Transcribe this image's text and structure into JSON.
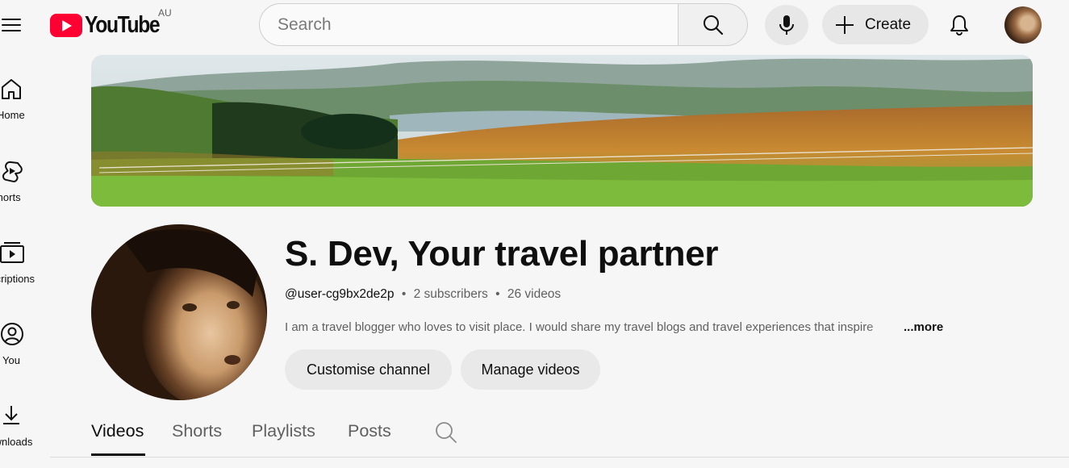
{
  "header": {
    "logo_text": "YouTube",
    "country_code": "AU",
    "search_placeholder": "Search",
    "create_label": "Create"
  },
  "sidebar": {
    "items": [
      {
        "label": "Home",
        "icon": "home-icon"
      },
      {
        "label": "Shorts",
        "icon": "shorts-icon"
      },
      {
        "label": "Subscriptions",
        "icon": "subscriptions-icon"
      },
      {
        "label": "You",
        "icon": "you-icon"
      },
      {
        "label": "Downloads",
        "icon": "download-icon"
      }
    ]
  },
  "channel": {
    "name": "S. Dev, Your travel partner",
    "handle": "@user-cg9bx2de2p",
    "subscribers": "2 subscribers",
    "videos": "26 videos",
    "separator": "•",
    "description": "I am a travel blogger who loves to visit place. I would share my travel blogs and travel experiences that inspire",
    "more_label": "...more",
    "customise_label": "Customise channel",
    "manage_label": "Manage videos"
  },
  "tabs": [
    {
      "label": "Videos",
      "active": true
    },
    {
      "label": "Shorts",
      "active": false
    },
    {
      "label": "Playlists",
      "active": false
    },
    {
      "label": "Posts",
      "active": false
    }
  ],
  "colors": {
    "brand_red": "#ff0033",
    "background": "#f6f6f6",
    "pill_bg": "#e9e9e9",
    "text_primary": "#0f0f0f",
    "text_secondary": "#606060"
  }
}
